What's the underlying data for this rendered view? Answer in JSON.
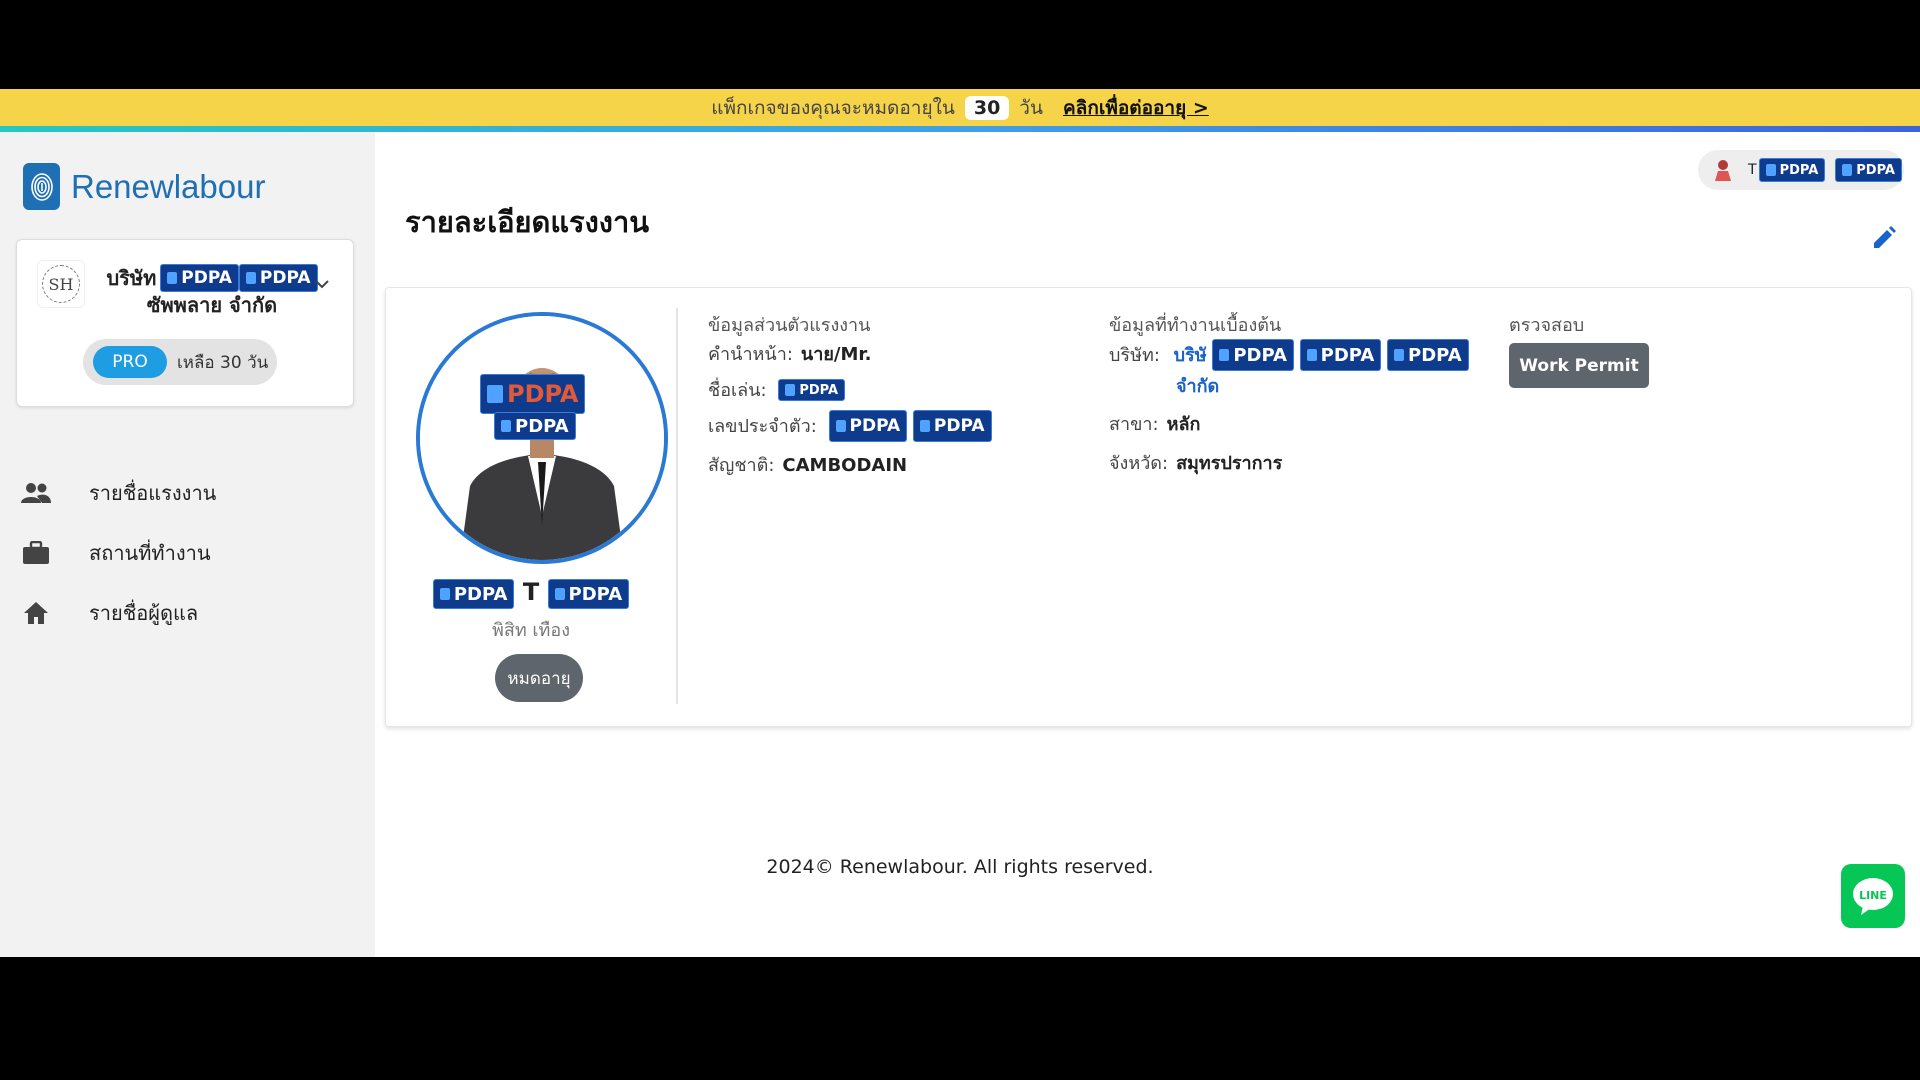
{
  "banner": {
    "text_before": "แพ็กเกจของคุณจะหมดอายุใน",
    "days": "30",
    "text_after": "วัน",
    "renew_link": "คลิกเพื่อต่ออายุ >"
  },
  "sidebar": {
    "logo_text": "Renewlabour",
    "company": {
      "avatar_text": "SH",
      "name_line1": "บริษัท",
      "name_line2": "ซัพพลาย จำกัด",
      "plan_badge": "PRO",
      "remaining": "เหลือ 30 วัน"
    },
    "nav": [
      {
        "label": "รายชื่อแรงงาน",
        "icon": "people-icon"
      },
      {
        "label": "สถานที่ทำงาน",
        "icon": "briefcase-icon"
      },
      {
        "label": "รายชื่อผู้ดูแล",
        "icon": "home-icon"
      }
    ]
  },
  "header": {
    "user_name": "PDPA",
    "title": "รายละเอียดแรงงาน"
  },
  "profile": {
    "name_en": "T",
    "name_th": "พิสิท เทือง",
    "status": "หมดอายุ",
    "pdpa_label": "PDPA"
  },
  "personal": {
    "section_title": "ข้อมูลส่วนตัวแรงงาน",
    "title_label": "คำนำหน้า:",
    "title_value": "นาย/Mr.",
    "nickname_label": "ชื่อเล่น:",
    "id_label": "เลขประจำตัว:",
    "nationality_label": "สัญชาติ:",
    "nationality_value": "CAMBODAIN"
  },
  "work": {
    "section_title": "ข้อมูลที่ทำงานเบื้องต้น",
    "company_label": "บริษัท:",
    "company_value_line1": "บริษั",
    "company_value_line2": "จำกัด",
    "branch_label": "สาขา:",
    "branch_value": "หลัก",
    "province_label": "จังหวัด:",
    "province_value": "สมุทรปราการ"
  },
  "verify": {
    "section_title": "ตรวจสอบ",
    "button_label": "Work Permit"
  },
  "footer": {
    "text": "2024© Renewlabour. All rights reserved."
  },
  "line_button": {
    "label": "LINE"
  }
}
